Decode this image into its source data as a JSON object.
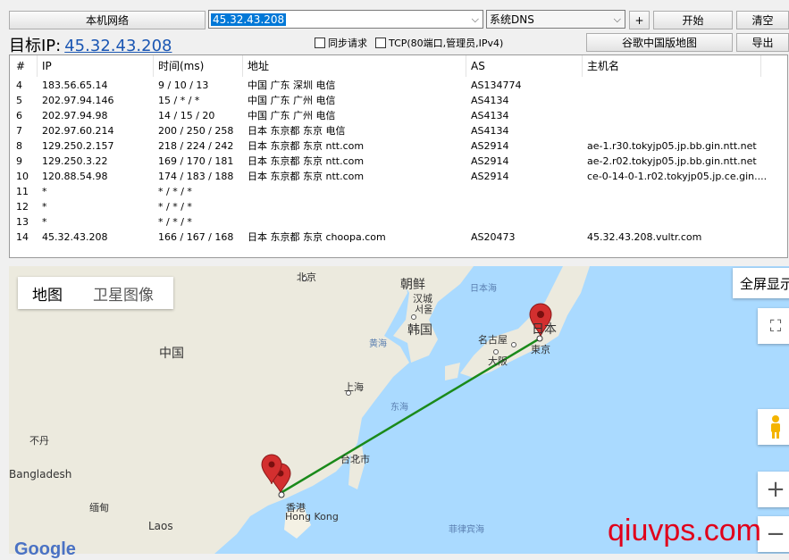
{
  "toolbar": {
    "local_network_label": "本机网络",
    "target_value": "45.32.43.208",
    "dns_value": "系统DNS",
    "add_label": "+",
    "start_label": "开始",
    "clear_label": "清空",
    "sync_request_label": "同步请求",
    "tcp_label": "TCP(80端口,管理员,IPv4)",
    "google_map_label": "谷歌中国版地图",
    "export_label": "导出",
    "target_title": "目标IP:",
    "target_ip": "45.32.43.208"
  },
  "table": {
    "headers": [
      "#",
      "IP",
      "时间(ms)",
      "地址",
      "AS",
      "主机名"
    ],
    "rows": [
      {
        "n": "4",
        "ip": "183.56.65.14",
        "time": "9 / 10 / 13",
        "addr": "中国 广东 深圳 电信",
        "as": "AS134774",
        "host": ""
      },
      {
        "n": "5",
        "ip": "202.97.94.146",
        "time": "15 / * / *",
        "addr": "中国 广东 广州 电信",
        "as": "AS4134",
        "host": ""
      },
      {
        "n": "6",
        "ip": "202.97.94.98",
        "time": "14 / 15 / 20",
        "addr": "中国 广东 广州 电信",
        "as": "AS4134",
        "host": ""
      },
      {
        "n": "7",
        "ip": "202.97.60.214",
        "time": "200 / 250 / 258",
        "addr": "日本 东京都 东京 电信",
        "as": "AS4134",
        "host": ""
      },
      {
        "n": "8",
        "ip": "129.250.2.157",
        "time": "218 / 224 / 242",
        "addr": "日本 东京都 东京 ntt.com",
        "as": "AS2914",
        "host": "ae-1.r30.tokyjp05.jp.bb.gin.ntt.net"
      },
      {
        "n": "9",
        "ip": "129.250.3.22",
        "time": "169 / 170 / 181",
        "addr": "日本 东京都 东京 ntt.com",
        "as": "AS2914",
        "host": "ae-2.r02.tokyjp05.jp.bb.gin.ntt.net"
      },
      {
        "n": "10",
        "ip": "120.88.54.98",
        "time": "174 / 183 / 188",
        "addr": "日本 东京都 东京 ntt.com",
        "as": "AS2914",
        "host": "ce-0-14-0-1.r02.tokyjp05.jp.ce.gin...."
      },
      {
        "n": "11",
        "ip": "*",
        "time": "* / * / *",
        "addr": "",
        "as": "",
        "host": ""
      },
      {
        "n": "12",
        "ip": "*",
        "time": "* / * / *",
        "addr": "",
        "as": "",
        "host": ""
      },
      {
        "n": "13",
        "ip": "*",
        "time": "* / * / *",
        "addr": "",
        "as": "",
        "host": ""
      },
      {
        "n": "14",
        "ip": "45.32.43.208",
        "time": "166 / 167 / 168",
        "addr": "日本 东京都 东京 choopa.com",
        "as": "AS20473",
        "host": "45.32.43.208.vultr.com"
      }
    ]
  },
  "map": {
    "tab_map": "地图",
    "tab_satellite": "卫星图像",
    "fullscreen_label": "全屏显示",
    "labels": {
      "beijing": "北京",
      "korea": "朝鲜",
      "hancheng": "汉城",
      "seoul": "서울",
      "korea_south": "韩国",
      "sea_japan": "日本海",
      "china": "中国",
      "yellow_sea": "黄海",
      "nagoya": "名古屋",
      "osaka": "大阪",
      "tokyo": "東京",
      "japan": "日本",
      "shanghai": "上海",
      "east_sea": "东海",
      "bhutan": "不丹",
      "bangladesh": "Bangladesh",
      "taipei": "台北市",
      "hongkong_cn": "香港",
      "hongkong_en": "Hong Kong",
      "myanmar": "缅甸",
      "laos": "Laos",
      "philippine_sea": "菲律宾海"
    },
    "google_logo": "Google"
  },
  "watermark": "qiuvps.com",
  "colors": {
    "route": "#1a8a1a",
    "pin": "#d32f2f",
    "water": "#aadaff",
    "land": "#eceade",
    "link": "#1a56b3"
  }
}
